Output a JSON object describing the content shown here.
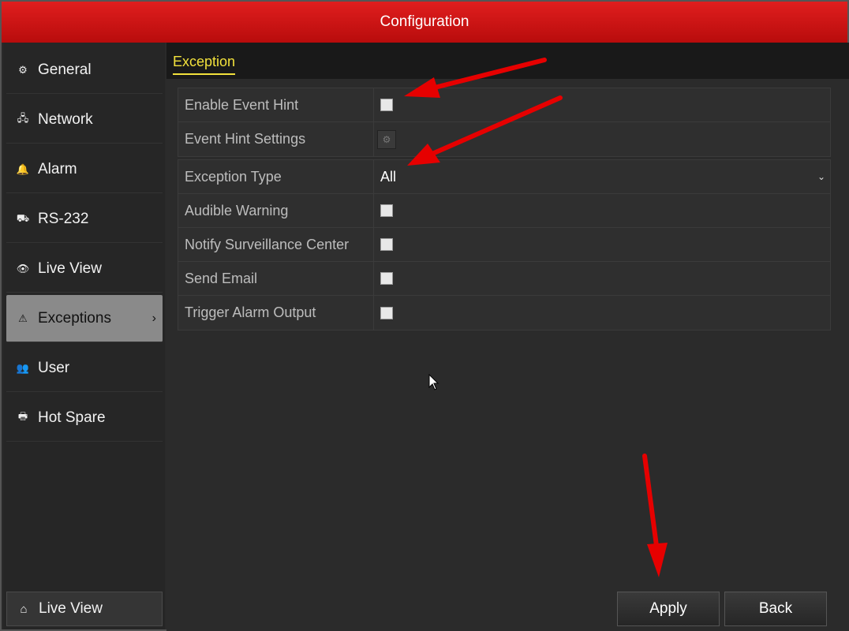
{
  "window": {
    "title": "Configuration"
  },
  "sidebar": {
    "items": [
      {
        "label": "General",
        "icon": "gear-icon",
        "glyph": "⚙"
      },
      {
        "label": "Network",
        "icon": "network-icon",
        "glyph": "🖧"
      },
      {
        "label": "Alarm",
        "icon": "alarm-bell-icon",
        "glyph": "🔔"
      },
      {
        "label": "RS-232",
        "icon": "serial-port-icon",
        "glyph": "⛟"
      },
      {
        "label": "Live View",
        "icon": "eye-icon",
        "glyph": "👁"
      },
      {
        "label": "Exceptions",
        "icon": "warning-icon",
        "glyph": "⚠",
        "active": true
      },
      {
        "label": "User",
        "icon": "users-icon",
        "glyph": "👥"
      },
      {
        "label": "Hot Spare",
        "icon": "hot-spare-icon",
        "glyph": "🖶"
      }
    ],
    "active_chevron": "›",
    "live_view": {
      "label": "Live View",
      "icon": "home-icon",
      "glyph": "⌂"
    }
  },
  "tabs": [
    {
      "label": "Exception",
      "active": true
    }
  ],
  "event_hint": {
    "enable_label": "Enable Event Hint",
    "enable_checked": false,
    "settings_label": "Event Hint Settings",
    "settings_icon": "gear-icon"
  },
  "exception": {
    "type_label": "Exception Type",
    "type_value": "All",
    "options": [
      {
        "label": "Audible Warning",
        "checked": false
      },
      {
        "label": "Notify Surveillance Center",
        "checked": false
      },
      {
        "label": "Send Email",
        "checked": false
      },
      {
        "label": "Trigger Alarm Output",
        "checked": false
      }
    ]
  },
  "buttons": {
    "apply": "Apply",
    "back": "Back"
  },
  "colors": {
    "title_bar": "#d01414",
    "tab_active": "#f2e13c",
    "annotation_arrow": "#e60000"
  }
}
